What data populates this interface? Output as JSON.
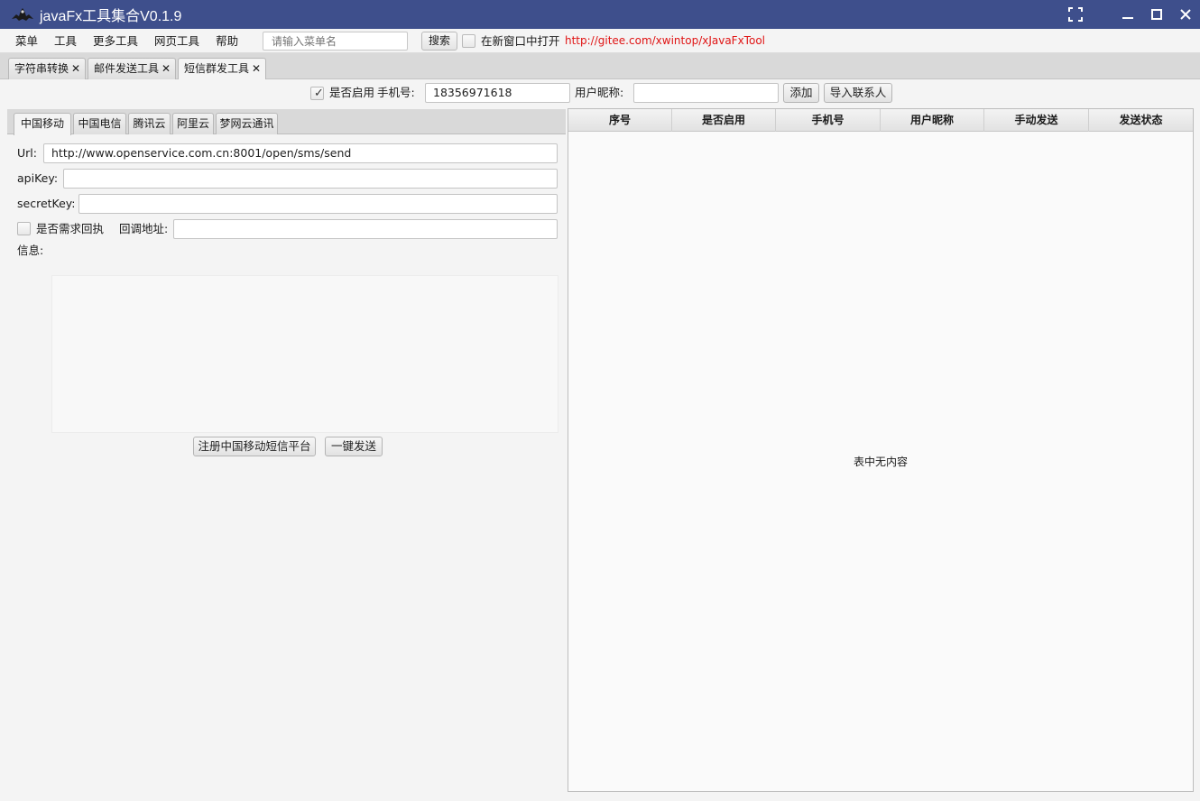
{
  "window": {
    "title": "javaFx工具集合V0.1.9",
    "controls": [
      "fullscreen-icon",
      "minimize-icon",
      "maximize-icon",
      "close-icon"
    ]
  },
  "menubar": {
    "menus": [
      "菜单",
      "工具",
      "更多工具",
      "网页工具",
      "帮助"
    ],
    "search_placeholder": "请输入菜单名",
    "search_button": "搜索",
    "new_window_label": "在新窗口中打开",
    "new_window_checked": false,
    "repo_link": "http://gitee.com/xwintop/xJavaFxTool"
  },
  "top_tabs": [
    {
      "label": "字符串转换",
      "active": false
    },
    {
      "label": "邮件发送工具",
      "active": false
    },
    {
      "label": "短信群发工具",
      "active": true
    }
  ],
  "contact_bar": {
    "enabled_label": "是否启用",
    "enabled_checked": true,
    "phone_label": "手机号:",
    "phone_value": "18356971618",
    "nickname_label": "用户昵称:",
    "nickname_value": "",
    "add_button": "添加",
    "import_button": "导入联系人"
  },
  "provider_tabs": [
    {
      "label": "中国移动",
      "active": true
    },
    {
      "label": "中国电信",
      "active": false
    },
    {
      "label": "腾讯云",
      "active": false
    },
    {
      "label": "阿里云",
      "active": false
    },
    {
      "label": "梦网云通讯",
      "active": false
    }
  ],
  "form": {
    "url_label": "Url:",
    "url_value": "http://www.openservice.com.cn:8001/open/sms/send",
    "apikey_label": "apiKey:",
    "apikey_value": "",
    "secretkey_label": "secretKey:",
    "secretkey_value": "",
    "receipt_label": "是否需求回执",
    "receipt_checked": false,
    "callback_label": "回调地址:",
    "callback_value": "",
    "message_label": "信息:",
    "message_value": "",
    "register_button": "注册中国移动短信平台",
    "send_button": "一键发送"
  },
  "table": {
    "columns": [
      "序号",
      "是否启用",
      "手机号",
      "用户昵称",
      "手动发送",
      "发送状态"
    ],
    "rows": [],
    "empty_text": "表中无内容"
  }
}
